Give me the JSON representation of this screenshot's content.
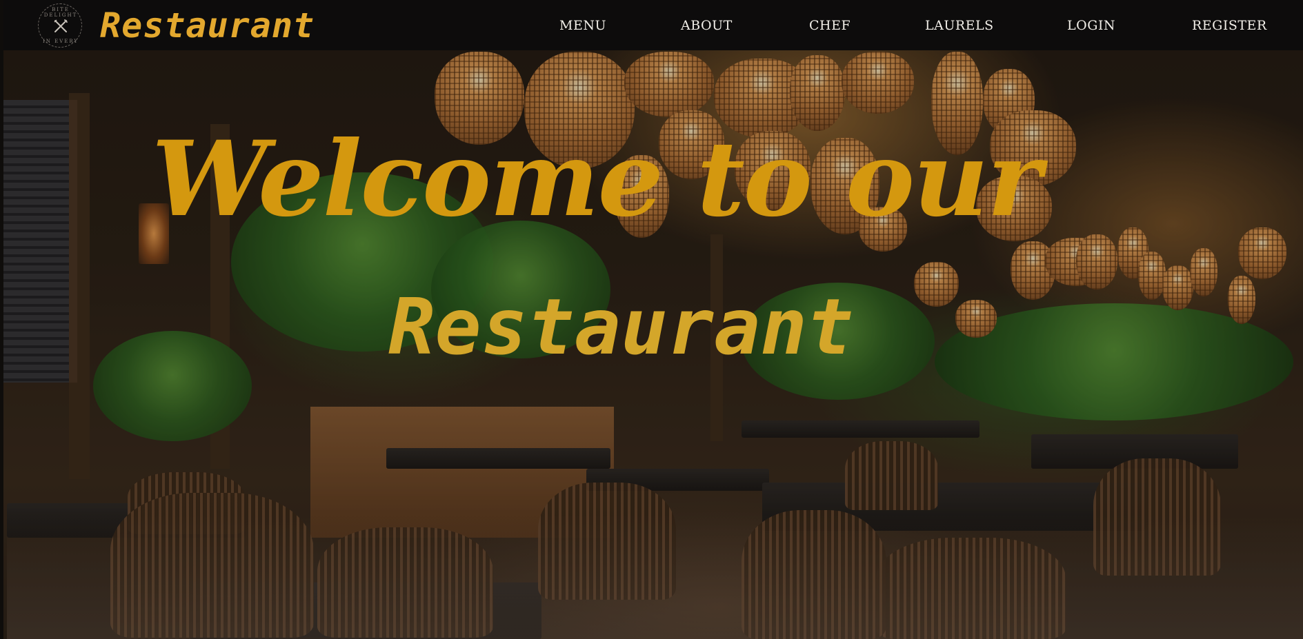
{
  "brand": {
    "name": "Restaurant",
    "badge_top": "BITE DELIGHT",
    "badge_bottom": "IN EVERY",
    "badge_icon": "fork-knife-icon",
    "accent_color": "#e3a82e"
  },
  "nav": {
    "items": [
      {
        "label": "MENU"
      },
      {
        "label": "ABOUT"
      },
      {
        "label": "CHEF"
      },
      {
        "label": "LAURELS"
      },
      {
        "label": "LOGIN"
      },
      {
        "label": "REGISTER"
      }
    ],
    "text_color": "#f2efe9",
    "background": "#0d0c0c"
  },
  "hero": {
    "line1": "Welcome to our",
    "line2": "Restaurant",
    "text_color": "#d4980f",
    "background": "restaurant-interior-photo"
  }
}
